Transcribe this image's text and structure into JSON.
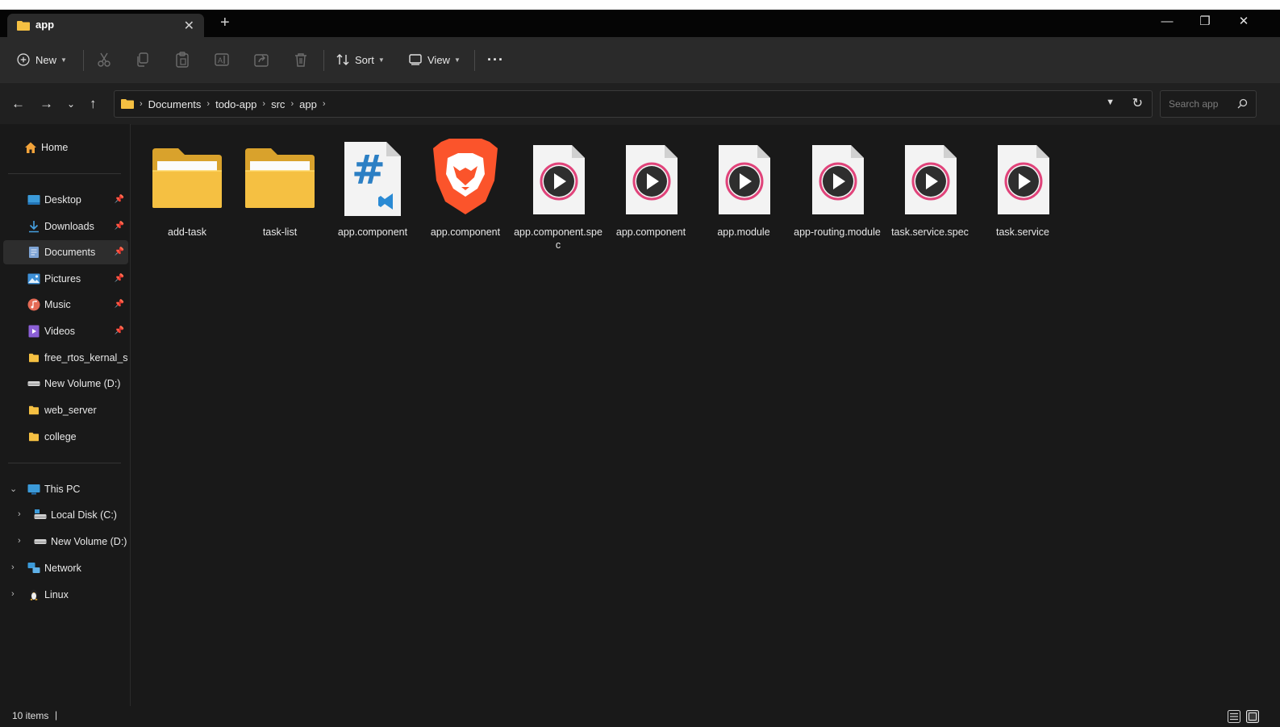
{
  "tab": {
    "title": "app",
    "close": "✕",
    "add": "+"
  },
  "window_controls": {
    "minimize": "—",
    "restore": "❐",
    "close": "✕"
  },
  "toolbar": {
    "new_label": "New",
    "sort_label": "Sort",
    "view_label": "View",
    "more": "···"
  },
  "address": {
    "crumbs": [
      "Documents",
      "todo-app",
      "src",
      "app"
    ],
    "crumb_separator": "›",
    "refresh": "↻"
  },
  "search": {
    "placeholder": "Search app"
  },
  "sidebar": {
    "home": "Home",
    "quick_access": [
      {
        "label": "Desktop",
        "icon": "desktop-icon",
        "pinned": true
      },
      {
        "label": "Downloads",
        "icon": "download-icon",
        "pinned": true
      },
      {
        "label": "Documents",
        "icon": "documents-icon",
        "pinned": true,
        "selected": true
      },
      {
        "label": "Pictures",
        "icon": "pictures-icon",
        "pinned": true
      },
      {
        "label": "Music",
        "icon": "music-icon",
        "pinned": true
      },
      {
        "label": "Videos",
        "icon": "videos-icon",
        "pinned": true
      },
      {
        "label": "free_rtos_kernal_sou",
        "icon": "folder-icon",
        "pinned": false
      },
      {
        "label": "New Volume (D:)",
        "icon": "drive-icon",
        "pinned": false
      },
      {
        "label": "web_server",
        "icon": "folder-icon",
        "pinned": false
      },
      {
        "label": "college",
        "icon": "folder-icon",
        "pinned": false
      }
    ],
    "this_pc": "This PC",
    "local_disk": "Local Disk (C:)",
    "new_volume": "New Volume (D:)",
    "network": "Network",
    "linux": "Linux"
  },
  "files": [
    {
      "name": "add-task",
      "icon": "folder"
    },
    {
      "name": "task-list",
      "icon": "folder"
    },
    {
      "name": "app.component",
      "icon": "css-vscode"
    },
    {
      "name": "app.component",
      "icon": "brave"
    },
    {
      "name": "app.component.spec",
      "icon": "media"
    },
    {
      "name": "app.component",
      "icon": "media"
    },
    {
      "name": "app.module",
      "icon": "media"
    },
    {
      "name": "app-routing.module",
      "icon": "media"
    },
    {
      "name": "task.service.spec",
      "icon": "media"
    },
    {
      "name": "task.service",
      "icon": "media"
    }
  ],
  "status": {
    "item_count": "10 items",
    "separator": "|"
  },
  "colors": {
    "background": "#191919",
    "toolbar": "#2a2a2a",
    "folder": "#f5c042",
    "brave": "#fb542b",
    "vscode": "#2a8ad4",
    "media_ring": "#e0437a"
  }
}
